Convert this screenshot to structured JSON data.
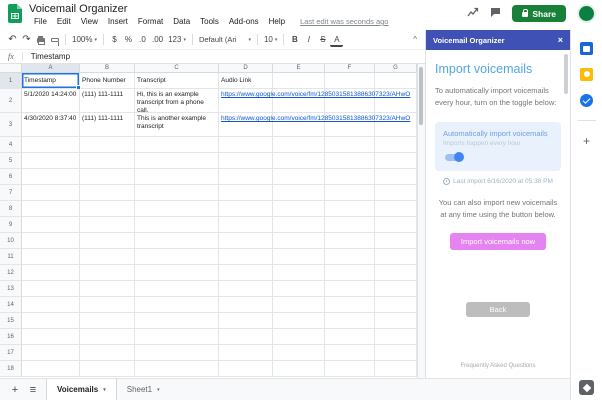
{
  "topbar": {
    "title": "Voicemail Organizer",
    "menus": [
      "File",
      "Edit",
      "View",
      "Insert",
      "Format",
      "Data",
      "Tools",
      "Add-ons",
      "Help"
    ],
    "last_edit": "Last edit was seconds ago",
    "share_label": "Share"
  },
  "toolbar": {
    "zoom": "100%",
    "currency": "$",
    "percent": "%",
    "dec_dec": ".0",
    "inc_dec": ".00",
    "more_formats": "123",
    "font_name": "Default (Ari",
    "font_size": "10",
    "bold": "B",
    "italic": "I",
    "strike": "S",
    "text_color": "A"
  },
  "formula_bar": {
    "fx": "fx",
    "value": "Timestamp"
  },
  "grid": {
    "col_letters": [
      "A",
      "B",
      "C",
      "D",
      "E",
      "F",
      "G"
    ],
    "row_numbers": [
      "1",
      "2",
      "3",
      "4",
      "5",
      "6",
      "7",
      "8",
      "9",
      "10",
      "11",
      "12",
      "13",
      "14",
      "15",
      "16",
      "17",
      "18"
    ],
    "cells": {
      "1": [
        "Timestamp",
        "Phone Number",
        "Transcript",
        "Audio Link"
      ],
      "2": [
        "5/1/2020 14:24:00",
        "(111) 111-1111",
        "Hi, this is an example transcript from a phone call.",
        "https://www.google.com/voice/fm/12850315813886307323/AHwO"
      ],
      "3": [
        "4/30/2020 8:37:40",
        "(111) 111-1111",
        "This is another example transcript",
        "https://www.google.com/voice/fm/12850315813886307323/AHwO"
      ]
    }
  },
  "sidebar": {
    "title": "Voicemail Organizer",
    "heading": "Import voicemails",
    "intro": "To automatically import voicemails every hour, turn on the toggle below:",
    "card": {
      "title": "Automatically import voicemails",
      "subtitle": "Imports happen every hour"
    },
    "last_import": "Last import 6/16/2020 at 05:38 PM",
    "body": "You can also import new voicemails at any time using the button below.",
    "import_button": "Import voicemails now",
    "back_button": "Back",
    "faq": "Frequently Asked Questions"
  },
  "tabs": {
    "active_label": "Voicemails",
    "inactive_label": "Sheet1"
  },
  "icons": {
    "undo": "↶",
    "redo": "↷",
    "caret": "▾",
    "collapse": "^",
    "close": "×",
    "menu": "≡",
    "plus": "+"
  },
  "colors": {
    "sheets_green": "#0f9d58",
    "share_green": "#188038",
    "sidebar_header": "#3f51b5",
    "heading_blue": "#4fa7e3",
    "card_bg": "#e8f1fc",
    "toggle_blue": "#4285f4",
    "import_pink": "#e583f0",
    "back_gray": "#bdbdbd",
    "link_blue": "#1155cc",
    "selection_blue": "#1a73e8"
  }
}
